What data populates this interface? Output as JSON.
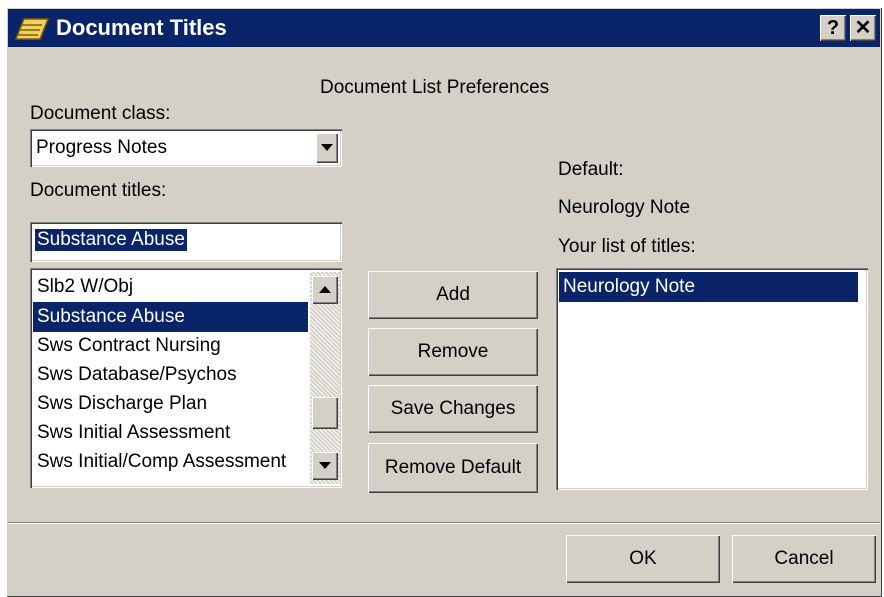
{
  "window": {
    "title": "Document Titles",
    "help_label": "?",
    "close_label": "✕"
  },
  "header": {
    "title": "Document List Preferences"
  },
  "document_class": {
    "label": "Document class:",
    "value": "Progress Notes"
  },
  "document_titles": {
    "label": "Document titles:",
    "search_value": "Substance Abuse",
    "items": [
      "Slb2 W/Obj",
      "Substance Abuse",
      "Sws Contract Nursing",
      "Sws Database/Psychos",
      "Sws Discharge Plan",
      "Sws Initial Assessment",
      "Sws Initial/Comp Assessment"
    ],
    "selected_index": 1
  },
  "actions": {
    "add": "Add",
    "remove": "Remove",
    "save_changes": "Save Changes",
    "remove_default": "Remove Default"
  },
  "default": {
    "label": "Default:",
    "value": "Neurology Note"
  },
  "your_list": {
    "label": "Your list of titles:",
    "items": [
      "Neurology Note"
    ],
    "selected_index": 0
  },
  "footer": {
    "ok": "OK",
    "cancel": "Cancel"
  },
  "icons": {
    "title_icon": "notebook-icon",
    "scroll_up": "up-arrow-icon",
    "scroll_down": "down-arrow-icon",
    "dropdown": "chevron-down-icon"
  },
  "colors": {
    "titlebar": "#0a246a",
    "face": "#d4d0c8",
    "selection": "#0a246a"
  }
}
